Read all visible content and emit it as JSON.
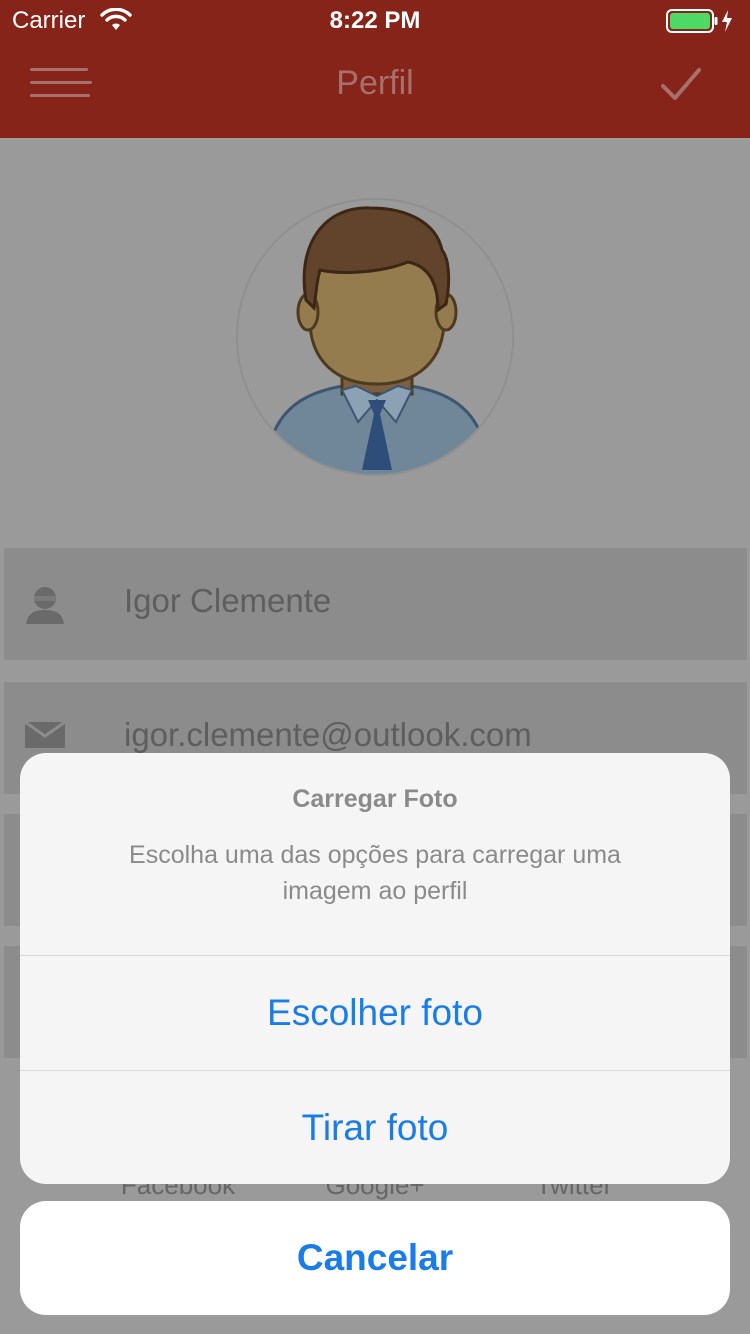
{
  "status_bar": {
    "carrier": "Carrier",
    "time": "8:22 PM"
  },
  "nav": {
    "title": "Perfil"
  },
  "form": {
    "name": "Igor Clemente",
    "email": "igor.clemente@outlook.com"
  },
  "social": {
    "facebook": "Facebook",
    "google": "Google+",
    "twitter": "Twitter"
  },
  "action_sheet": {
    "title": "Carregar Foto",
    "message": "Escolha uma das opções para carregar uma imagem ao perfil",
    "choose_photo": "Escolher foto",
    "take_photo": "Tirar foto",
    "cancel": "Cancelar"
  },
  "colors": {
    "nav_bar": "#87241a",
    "action_blue": "#1a7ce8",
    "dim_overlay": "#9a9a9a",
    "battery_green": "#4cd964"
  },
  "icons": [
    "wifi-icon",
    "battery-icon",
    "charging-bolt-icon",
    "menu-icon",
    "checkmark-icon",
    "user-icon",
    "mail-icon"
  ]
}
